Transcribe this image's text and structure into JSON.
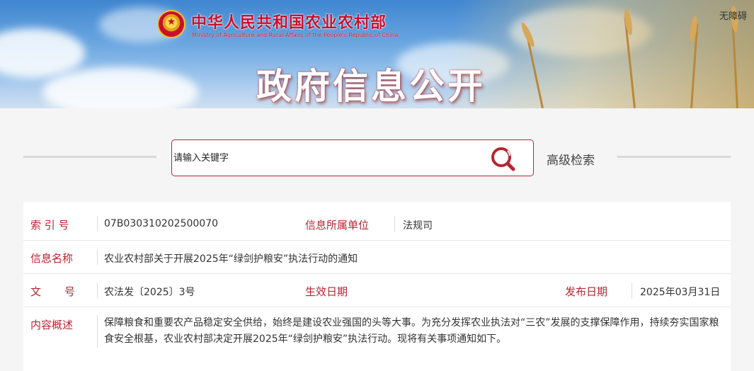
{
  "header": {
    "ministry_name_cn": "中华人民共和国农业农村部",
    "ministry_name_en": "Ministry of Agriculture and Rural Affairs of the People's Republic of China",
    "accessibility_label": "无障碍",
    "section_title": "政府信息公开"
  },
  "search": {
    "placeholder": "请输入关键字",
    "advanced_label": "高级检索"
  },
  "info": {
    "index_label": "索 引 号",
    "index_value": "07B030310202500070",
    "org_label": "信息所属单位",
    "org_value": "法规司",
    "name_label": "信息名称",
    "name_value": "农业农村部关于开展2025年“绿剑护粮安”执法行动的通知",
    "doc_label_1": "文",
    "doc_label_2": "号",
    "doc_value": "农法发〔2025〕3号",
    "effective_label": "生效日期",
    "effective_value": "",
    "publish_label": "发布日期",
    "publish_value": "2025年03月31日",
    "summary_label": "内容概述",
    "summary_value": "保障粮食和重要农产品稳定安全供给，始终是建设农业强国的头等大事。为充分发挥农业执法对“三农”发展的支撑保障作用，持续夯实国家粮食安全根基，农业农村部决定开展2025年“绿剑护粮安”执法行动。现将有关事项通知如下。"
  },
  "colors": {
    "accent": "#b52531",
    "banner_sky": "#5e9ddb"
  }
}
